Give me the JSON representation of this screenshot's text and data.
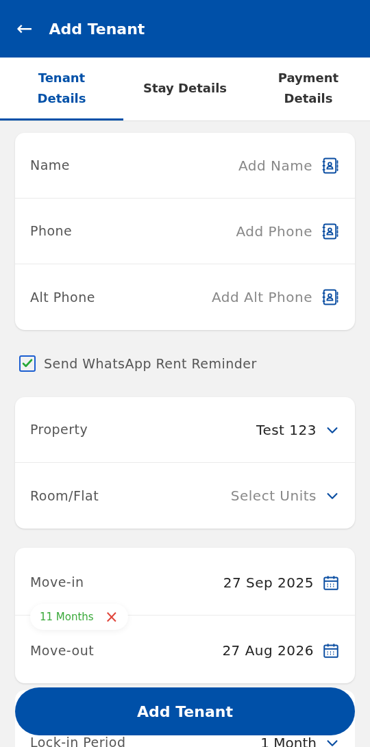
{
  "header": {
    "back": "←",
    "title": "Add Tenant"
  },
  "tabs": [
    {
      "label": "Tenant Details",
      "selected": true
    },
    {
      "label": "Stay Details",
      "selected": false
    },
    {
      "label": "Payment Details",
      "selected": false
    }
  ],
  "contact_fields": [
    {
      "label": "Name",
      "placeholder": "Add Name"
    },
    {
      "label": "Phone",
      "placeholder": "Add Phone"
    },
    {
      "label": "Alt Phone",
      "placeholder": "Add Alt Phone"
    }
  ],
  "reminder": {
    "label": "Send WhatsApp Rent Reminder",
    "checked": true
  },
  "property_fields": [
    {
      "label": "Property",
      "value": "Test 123"
    },
    {
      "label": "Room/Flat",
      "placeholder": "Select Units"
    }
  ],
  "stay_fields": [
    {
      "label": "Move-in",
      "value": "27 Sep 2025",
      "kind": "date"
    },
    {
      "label": "Move-out",
      "value": "27 Aug 2026",
      "kind": "date"
    }
  ],
  "duration_badge": {
    "label": "11 Months",
    "remove": "×"
  },
  "lock_in": {
    "label": "Lock-in Period",
    "value": "1 Month",
    "kind": "select"
  },
  "submit": "Add Tenant"
}
